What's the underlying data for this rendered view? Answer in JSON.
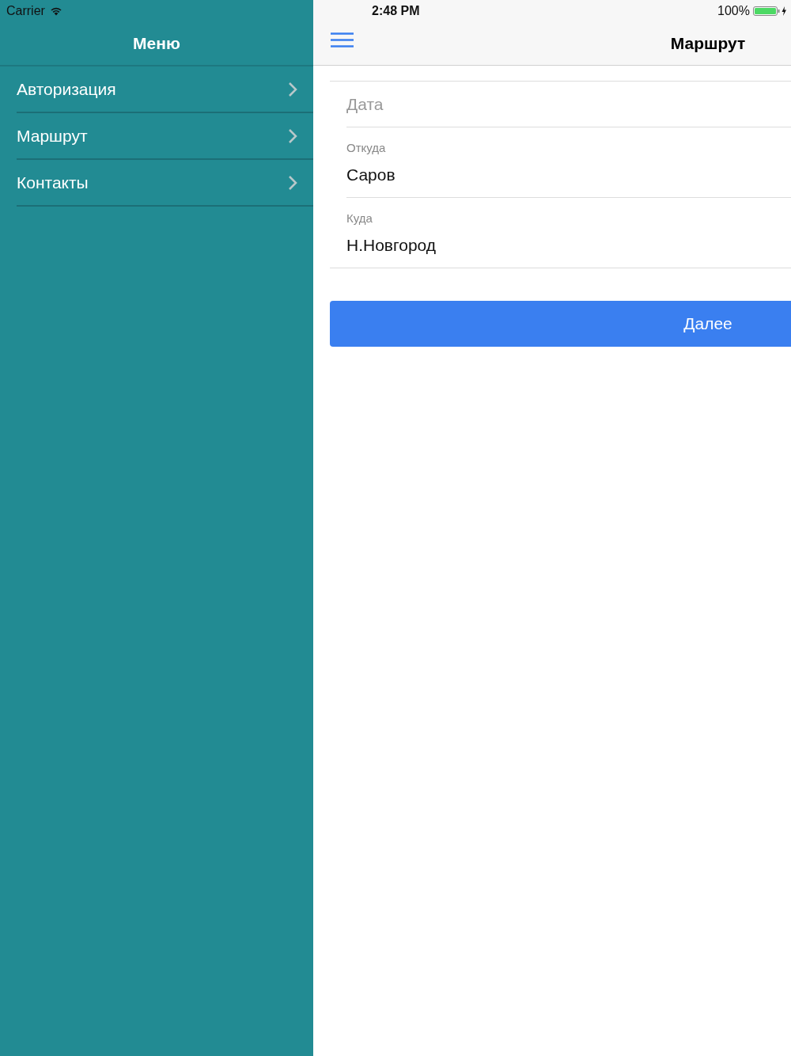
{
  "status_bar": {
    "carrier": "Carrier",
    "time": "2:48 PM",
    "battery": "100%"
  },
  "menu": {
    "title": "Меню",
    "items": [
      {
        "label": "Авторизация"
      },
      {
        "label": "Маршрут"
      },
      {
        "label": "Контакты"
      }
    ]
  },
  "nav": {
    "title": "Маршрут"
  },
  "form": {
    "fields": [
      {
        "kind": "plain",
        "placeholder": "Дата"
      },
      {
        "kind": "labeled",
        "label": "Откуда",
        "value": "Саров"
      },
      {
        "kind": "labeled",
        "label": "Куда",
        "value": "Н.Новгород"
      }
    ],
    "button": "Далее"
  }
}
